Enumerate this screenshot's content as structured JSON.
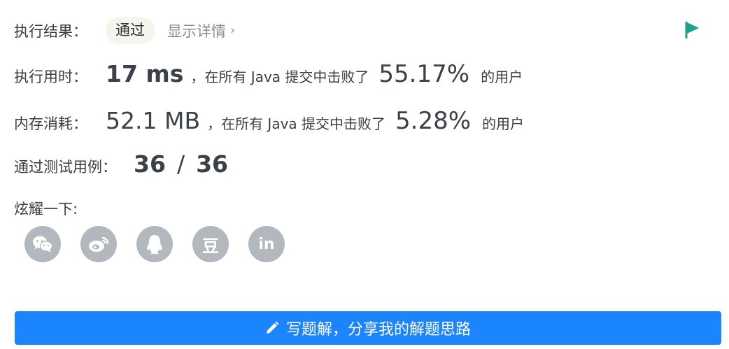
{
  "result": {
    "label": "执行结果：",
    "status": "通过",
    "details_link": "显示详情",
    "chevron": "›"
  },
  "runtime": {
    "label": "执行用时：",
    "value": "17 ms",
    "sep": "，在所有 Java 提交中击败了",
    "percent": "55.17%",
    "suffix": "的用户"
  },
  "memory": {
    "label": "内存消耗：",
    "value": "52.1 MB",
    "sep": "，在所有 Java 提交中击败了",
    "percent": "5.28%",
    "suffix": "的用户"
  },
  "tests": {
    "label": "通过测试用例：",
    "passed": "36",
    "divider": "/",
    "total": "36"
  },
  "share": {
    "label": "炫耀一下:",
    "icons": [
      "wechat-icon",
      "weibo-icon",
      "qq-icon",
      "douban-icon",
      "linkedin-icon"
    ],
    "douban_glyph": "豆",
    "linkedin_glyph": "in"
  },
  "solution_button": {
    "label": "写题解，分享我的解题思路",
    "icon": "pencil-icon"
  },
  "colors": {
    "accent": "#1a85ff",
    "flag": "#1aa38a",
    "icon_bg": "#b3b8bf",
    "badge_bg": "#f2f6ec"
  }
}
